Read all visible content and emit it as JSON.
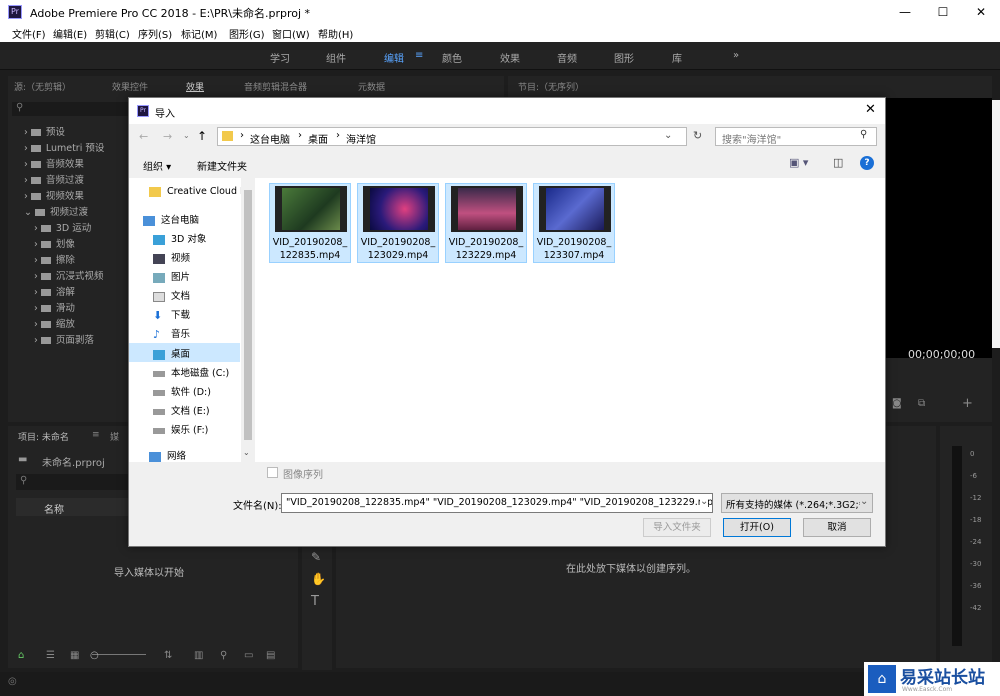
{
  "app": {
    "title": "Adobe Premiere Pro CC 2018 - E:\\PR\\未命名.prproj *",
    "icon_text": "Pr",
    "window_controls": [
      "—",
      "☐",
      "✕"
    ]
  },
  "menu": [
    "文件(F)",
    "编辑(E)",
    "剪辑(C)",
    "序列(S)",
    "标记(M)",
    "图形(G)",
    "窗口(W)",
    "帮助(H)"
  ],
  "workspaces": {
    "items": [
      "学习",
      "组件",
      "编辑",
      "颜色",
      "效果",
      "音频",
      "图形",
      "库"
    ],
    "active": "编辑",
    "more": "»"
  },
  "effects_panel": {
    "tabs": [
      "源:（无剪辑）",
      "效果控件",
      "效果",
      "音频剪辑混合器",
      "元数据"
    ],
    "tree": [
      "预设",
      "Lumetri 预设",
      "音频效果",
      "音频过渡",
      "视频效果",
      "视频过渡",
      "3D 运动",
      "划像",
      "擦除",
      "沉浸式视频",
      "溶解",
      "滑动",
      "缩放",
      "页面剥落"
    ]
  },
  "program_monitor": {
    "title": "节目:（无序列）",
    "timecode": "00;00;00;00"
  },
  "project_panel": {
    "tab": "项目: 未命名",
    "tab2": "媒",
    "file": "未命名.prproj",
    "column": "名称",
    "empty_text": "导入媒体以开始"
  },
  "timeline": {
    "empty_text": "在此处放下媒体以创建序列。"
  },
  "audio_meter": {
    "ticks": [
      "0",
      "-6",
      "-12",
      "-18",
      "-24",
      "-30",
      "-36",
      "-42"
    ]
  },
  "dialog": {
    "title": "导入",
    "breadcrumb": [
      "这台电脑",
      "桌面",
      "海洋馆"
    ],
    "search_placeholder": "搜索\"海洋馆\"",
    "toolbar": {
      "organize": "组织 ▾",
      "new_folder": "新建文件夹"
    },
    "nav_items": [
      {
        "label": "Creative Cloud F",
        "icon": "creative-cloud-icon"
      },
      {
        "label": "这台电脑",
        "icon": "pc-icon"
      },
      {
        "label": "3D 对象",
        "icon": "3d-objects-icon"
      },
      {
        "label": "视频",
        "icon": "video-icon"
      },
      {
        "label": "图片",
        "icon": "pictures-icon"
      },
      {
        "label": "文档",
        "icon": "documents-icon"
      },
      {
        "label": "下载",
        "icon": "download-icon"
      },
      {
        "label": "音乐",
        "icon": "music-icon"
      },
      {
        "label": "桌面",
        "icon": "desktop-icon"
      },
      {
        "label": "本地磁盘 (C:)",
        "icon": "drive-icon"
      },
      {
        "label": "软件 (D:)",
        "icon": "drive-icon"
      },
      {
        "label": "文档 (E:)",
        "icon": "drive-icon"
      },
      {
        "label": "娱乐 (F:)",
        "icon": "drive-icon"
      },
      {
        "label": "网络",
        "icon": "network-icon"
      }
    ],
    "files": [
      {
        "line1": "VID_20190208_",
        "line2": "122835.mp4"
      },
      {
        "line1": "VID_20190208_",
        "line2": "123029.mp4"
      },
      {
        "line1": "VID_20190208_",
        "line2": "123229.mp4"
      },
      {
        "line1": "VID_20190208_",
        "line2": "123307.mp4"
      }
    ],
    "image_sequence_label": "图像序列",
    "filename_label": "文件名(N):",
    "filename_value": "\"VID_20190208_122835.mp4\" \"VID_20190208_123029.mp4\" \"VID_20190208_123229.mp4\"",
    "filetype_value": "所有支持的媒体 (*.264;*.3G2;*",
    "import_folder_button": "导入文件夹",
    "open_button": "打开(O)",
    "cancel_button": "取消"
  },
  "watermark": {
    "text": "易采站长站",
    "subtext": "Www.Easck.Com"
  }
}
